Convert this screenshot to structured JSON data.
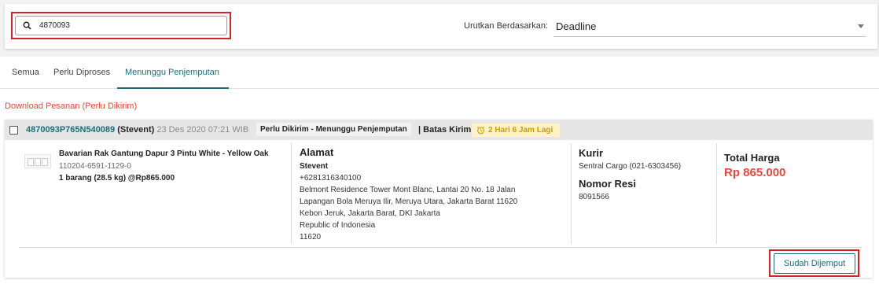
{
  "search": {
    "value": "4870093",
    "icon": "search-icon"
  },
  "sort": {
    "label": "Urutkan Berdasarkan:",
    "value": "Deadline"
  },
  "tabs": [
    {
      "label": "Semua"
    },
    {
      "label": "Perlu Diproses"
    },
    {
      "label": "Menunggu Penjemputan",
      "active": true
    }
  ],
  "download_link": "Download Pesanan (Perlu Dikirim)",
  "order": {
    "invoice": "4870093P765N540089",
    "buyer": "(Stevent)",
    "date": "23 Des 2020 07:21 WIB",
    "status": "Perlu Dikirim - Menunggu Penjemputan",
    "batas_label": "| Batas Kirim",
    "deadline": "2 Hari 6 Jam Lagi",
    "product": {
      "name": "Bavarian Rak Gantung Dapur 3 Pintu White - Yellow Oak",
      "sku": "110204-6591-1129-0",
      "qty": "1 barang (28.5 kg) @Rp865.000"
    },
    "address": {
      "title": "Alamat",
      "name": "Stevent",
      "phone": "+6281316340100",
      "line1": "Belmont Residence Tower Mont Blanc, Lantai 20 No. 18 Jalan",
      "line2": "Lapangan Bola Meruya Ilir, Meruya Utara, Jakarta Barat 11620",
      "line3": "Kebon Jeruk, Jakarta Barat, DKI Jakarta",
      "country": "Republic of Indonesia",
      "postal": "11620"
    },
    "courier": {
      "title": "Kurir",
      "value": "Sentral Cargo (021-6303456)",
      "resi_title": "Nomor Resi",
      "resi_value": "8091566"
    },
    "total": {
      "title": "Total Harga",
      "value": "Rp 865.000"
    },
    "action_button": "Sudah Dijemput"
  },
  "colors": {
    "accent": "#1a6e7a",
    "danger": "#e8473c",
    "highlight": "#d6202a",
    "deadline_bg": "#fff2c4",
    "deadline_text": "#c9a000"
  }
}
